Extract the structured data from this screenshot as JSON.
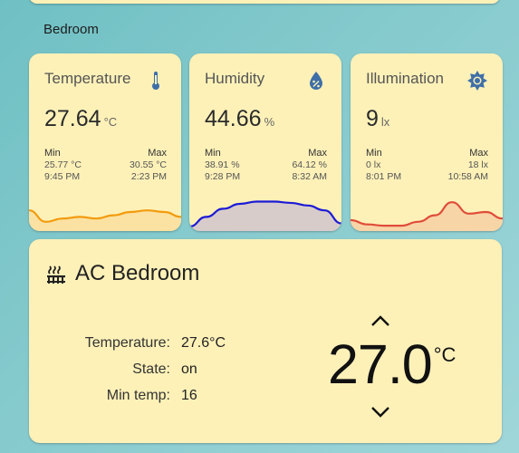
{
  "section": {
    "title": "Bedroom"
  },
  "sensors": [
    {
      "title": "Temperature",
      "value": "27.64",
      "unit": "°C",
      "icon": "thermometer-icon",
      "min_label": "Min",
      "max_label": "Max",
      "min_value": "25.77 °C",
      "min_time": "9:45 PM",
      "max_value": "30.55 °C",
      "max_time": "2:23 PM",
      "line_color": "#f29b0e",
      "fill_color": "#fbe2a2",
      "trend": [
        0.55,
        0.2,
        0.3,
        0.35,
        0.3,
        0.4,
        0.5,
        0.55,
        0.5,
        0.35
      ]
    },
    {
      "title": "Humidity",
      "value": "44.66",
      "unit": "%",
      "icon": "water-percent-icon",
      "min_label": "Min",
      "max_label": "Max",
      "min_value": "38.91 %",
      "min_time": "9:28 PM",
      "max_value": "64.12 %",
      "max_time": "8:32 AM",
      "line_color": "#1b1bd6",
      "fill_color": "#d8cccb",
      "trend": [
        0.05,
        0.35,
        0.6,
        0.75,
        0.82,
        0.82,
        0.78,
        0.7,
        0.55,
        0.15
      ]
    },
    {
      "title": "Illumination",
      "value": "9",
      "unit": "lx",
      "icon": "sun-icon",
      "min_label": "Min",
      "max_label": "Max",
      "min_value": "0 lx",
      "min_time": "8:01 PM",
      "max_value": "18 lx",
      "max_time": "10:58 AM",
      "line_color": "#e04c3a",
      "fill_color": "#f8d5a6",
      "trend": [
        0.25,
        0.12,
        0.08,
        0.08,
        0.2,
        0.4,
        0.8,
        0.45,
        0.5,
        0.3
      ]
    }
  ],
  "ac": {
    "icon": "heating-icon",
    "title": "AC Bedroom",
    "attributes": [
      {
        "label": "Temperature:",
        "value": "27.6°C"
      },
      {
        "label": "State:",
        "value": "on"
      },
      {
        "label": "Min temp:",
        "value": "16"
      }
    ],
    "target": "27.0",
    "target_unit": "°C"
  }
}
